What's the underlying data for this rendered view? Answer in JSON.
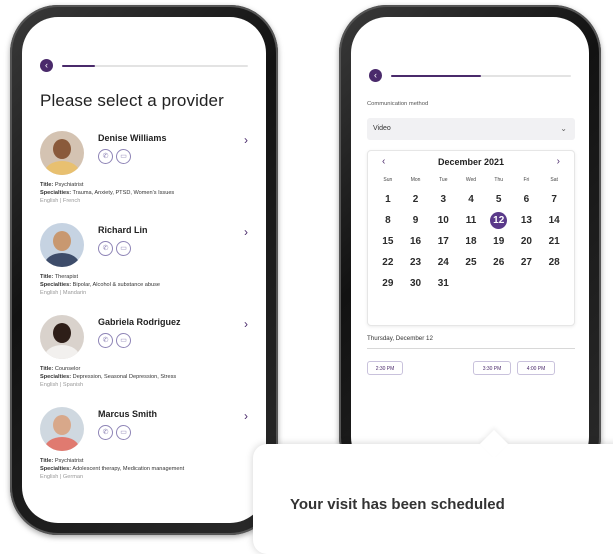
{
  "left_screen": {
    "title": "Please select a provider",
    "providers": [
      {
        "name": "Denise Williams",
        "title_label": "Title:",
        "title": "Psychiatrist",
        "spec_label": "Specialties:",
        "specialties": "Trauma, Anxiety, PTSD, Women's Issues",
        "languages": "English | French"
      },
      {
        "name": "Richard Lin",
        "title_label": "Title:",
        "title": "Therapist",
        "spec_label": "Specialties:",
        "specialties": "Bipolar, Alcohol & substance abuse",
        "languages": "English | Mandarin"
      },
      {
        "name": "Gabriela Rodriguez",
        "title_label": "Title:",
        "title": "Counselor",
        "spec_label": "Specialties:",
        "specialties": "Depression, Seasonal Depression, Stress",
        "languages": "English | Spanish"
      },
      {
        "name": "Marcus Smith",
        "title_label": "Title:",
        "title": "Psychiatrist",
        "spec_label": "Specialties:",
        "specialties": "Adolescent therapy, Medication management",
        "languages": "English | German"
      }
    ],
    "progress": 0.18
  },
  "right_screen": {
    "progress": 0.5,
    "comm_label": "Communication method",
    "comm_value": "Video",
    "calendar": {
      "month": "December 2021",
      "weekdays": [
        "Sun",
        "Mon",
        "Tue",
        "Wed",
        "Thu",
        "Fri",
        "Sat"
      ],
      "days": [
        [
          "1",
          "2",
          "3",
          "4",
          "5",
          "6",
          "7"
        ],
        [
          "8",
          "9",
          "10",
          "11",
          "12",
          "13",
          "14"
        ],
        [
          "15",
          "16",
          "17",
          "18",
          "19",
          "20",
          "21"
        ],
        [
          "22",
          "23",
          "24",
          "25",
          "26",
          "27",
          "28"
        ],
        [
          "29",
          "30",
          "31",
          "",
          "",
          "",
          ""
        ]
      ],
      "selected": "12"
    },
    "selected_date": "Thursday, December 12",
    "slots": [
      "2:30 PM",
      "3:30 PM",
      "4:00 PM"
    ]
  },
  "confirmation": {
    "message": "Your visit has been scheduled"
  },
  "colors": {
    "accent": "#4a2a6b",
    "icon_ring": "#8e84b6",
    "selected_day": "#5a3a8a"
  }
}
